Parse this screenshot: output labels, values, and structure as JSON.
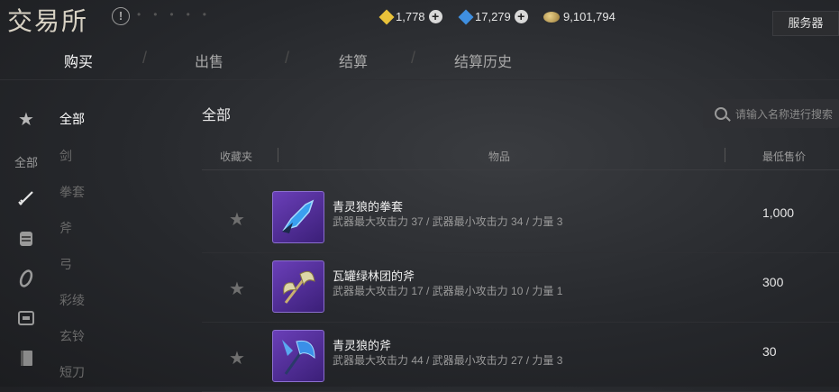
{
  "app": {
    "title": "交易所",
    "info_icon": "!",
    "server_label": "服务器"
  },
  "currencies": [
    {
      "icon": "yellow-diamond-icon",
      "color": "#e9c23a",
      "value": "1,778",
      "plus": "+"
    },
    {
      "icon": "blue-diamond-icon",
      "color": "#3f8fe0",
      "value": "17,279",
      "plus": "+"
    },
    {
      "icon": "coin-stack-icon",
      "color": "#c9a652",
      "value": "9,101,794"
    }
  ],
  "tabs": [
    {
      "label": "购买",
      "active": true
    },
    {
      "label": "出售",
      "active": false
    },
    {
      "label": "结算",
      "active": false
    },
    {
      "label": "结算历史",
      "active": false
    }
  ],
  "sidebar": {
    "all_label": "全部",
    "icons": [
      "star-icon",
      "sword-icon",
      "gauntlet-icon",
      "bracelet-icon",
      "chest-icon",
      "book-icon"
    ]
  },
  "categories": [
    "全部",
    "剑",
    "拳套",
    "斧",
    "弓",
    "彩绫",
    "玄铃",
    "短刀"
  ],
  "main": {
    "title": "全部",
    "search_placeholder": "请输入名称进行搜索",
    "columns": {
      "favorite": "收藏夹",
      "item": "物品",
      "price": "最低售价"
    }
  },
  "items": [
    {
      "name": "青灵狼的拳套",
      "stats": "武器最大攻击力 37   /  武器最小攻击力 34   /  力量 3",
      "price": "1,000"
    },
    {
      "name": "瓦罐绿林团的斧",
      "stats": "武器最大攻击力 17   /  武器最小攻击力 10   /  力量 1",
      "price": "300"
    },
    {
      "name": "青灵狼的斧",
      "stats": "武器最大攻击力 44   /  武器最小攻击力 27   /  力量 3",
      "price": "30"
    }
  ]
}
